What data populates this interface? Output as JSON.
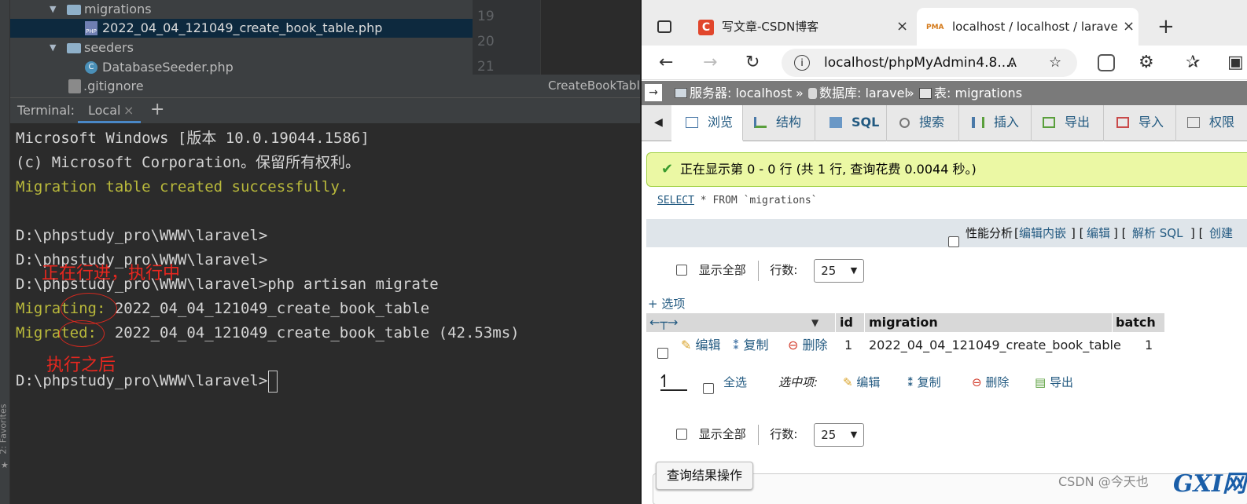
{
  "ide": {
    "tree": {
      "migrations_folder": "migrations",
      "selected_file": "2022_04_04_121049_create_book_table.php",
      "seeders_folder": "seeders",
      "seeder_file": "DatabaseSeeder.php",
      "gitignore": ".gitignore"
    },
    "editor": {
      "line_numbers": [
        "19",
        "20",
        "21"
      ],
      "tab_label": "CreateBookTable"
    },
    "terminal": {
      "label": "Terminal:",
      "tab": "Local",
      "add": "+",
      "lines": {
        "l1": "Microsoft Windows [版本 10.0.19044.1586]",
        "l2": "(c) Microsoft Corporation。保留所有权利。",
        "l3": "Migration table created successfully.",
        "l4": "D:\\phpstudy_pro\\WWW\\laravel>",
        "l5": "D:\\phpstudy_pro\\WWW\\laravel>",
        "l6": "D:\\phpstudy_pro\\WWW\\laravel>php artisan migrate",
        "l7_label": "Migrating:",
        "l7_text": " 2022_04_04_121049_create_book_table",
        "l8_label": "Migrated:",
        "l8_text": "  2022_04_04_121049_create_book_table (42.53ms)",
        "l9": "D:\\phpstudy_pro\\WWW\\laravel>"
      },
      "annotation_running": "正在行进，执行中",
      "annotation_after": "执行之后"
    },
    "side_label": "2: Favorites"
  },
  "browser": {
    "tabs": [
      {
        "label": "写文章-CSDN博客",
        "close": "×"
      },
      {
        "label": "localhost / localhost / laravel / m",
        "close": "×"
      }
    ],
    "new_tab": "+",
    "url": "localhost/phpMyAdmin4.8....",
    "pma": {
      "breadcrumb": {
        "server": "服务器: localhost",
        "db": "数据库: laravel",
        "table": "表: migrations",
        "sep": "»"
      },
      "menu": [
        "浏览",
        "结构",
        "SQL",
        "搜索",
        "插入",
        "导出",
        "导入",
        "权限"
      ],
      "success": "正在显示第 0 - 0 行 (共 1 行, 查询花费 0.0044 秒。)",
      "sql": {
        "kw1": "SELECT",
        "rest": " * FROM `migrations`"
      },
      "profiling": {
        "label": "性能分析",
        "l1": "编辑内嵌",
        "l2": "编辑",
        "l3": "解析 SQL",
        "l4": "创建"
      },
      "show_all": "显示全部",
      "rows_label": "行数:",
      "rows_value": "25",
      "options": "+ 选项",
      "columns": {
        "id": "id",
        "migration": "migration",
        "batch": "batch"
      },
      "row": {
        "edit": "编辑",
        "copy": "复制",
        "delete": "删除",
        "id": "1",
        "migration": "2022_04_04_121049_create_book_table",
        "batch": "1"
      },
      "bulk": {
        "select_all": "全选",
        "selected": "选中项:",
        "edit": "编辑",
        "copy": "复制",
        "delete": "删除",
        "export": "导出"
      },
      "query_ops": "查询结果操作",
      "watermark": "CSDN @今天也",
      "watermark2": "GXI网"
    }
  }
}
